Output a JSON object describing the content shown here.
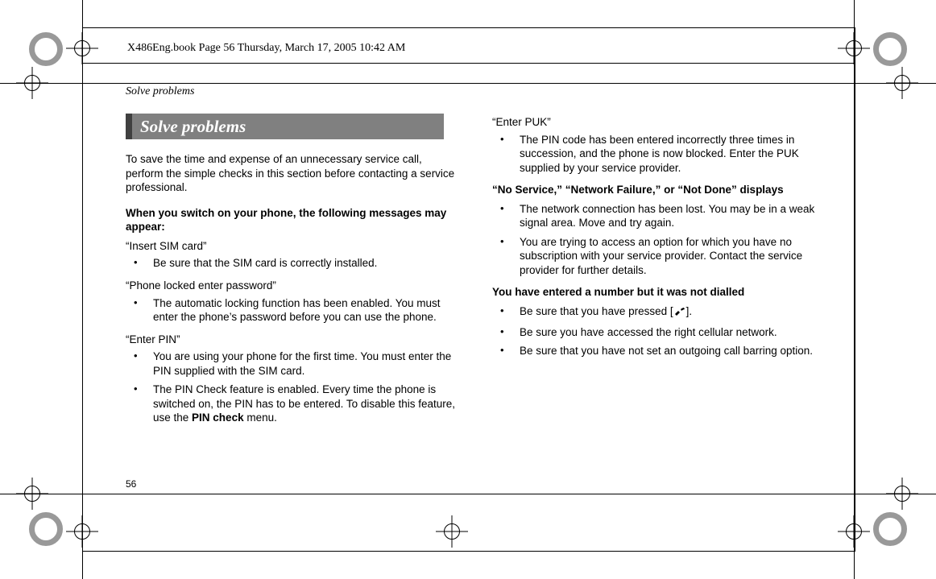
{
  "file_date_line": "X486Eng.book  Page 56  Thursday, March 17, 2005  10:42 AM",
  "running_head": "Solve problems",
  "section_title": "Solve problems",
  "intro": "To save the time and expense of an unnecessary service call, perform the simple checks in this section before contacting a service professional.",
  "page_number": "56",
  "left": {
    "head1": "When you switch on your phone, the following messages may appear:",
    "sub1": "“Insert SIM card”",
    "b1": "Be sure that the SIM card is correctly installed.",
    "sub2": "“Phone locked enter password”",
    "b2": "The automatic locking function has been enabled. You must enter the phone’s password before you can use the phone.",
    "sub3": "“Enter PIN”",
    "b3a": "You are using your phone for the first time. You must enter the PIN supplied with the SIM card.",
    "b3b_pre": "The PIN Check feature is enabled. Every time the phone is switched on, the PIN has to be entered. To disable this feature, use the ",
    "b3b_bold": "PIN check",
    "b3b_post": " menu."
  },
  "right": {
    "sub1": "“Enter PUK”",
    "b1": "The PIN code has been entered incorrectly three times in succession, and the phone is now blocked. Enter the PUK supplied by your service provider.",
    "head2": "“No Service,” “Network Failure,” or “Not Done” displays",
    "b2a": "The network connection has been lost. You may be in a weak signal area. Move and try again.",
    "b2b": "You are trying to access an option for which you have no subscription with your service provider. Contact the service provider for further details.",
    "head3": "You have entered a number but it was not dialled",
    "b3a_pre": "Be sure that you have pressed [",
    "b3a_post": "].",
    "b3b": "Be sure you have accessed the right cellular network.",
    "b3c": "Be sure that you have not set an outgoing call barring option."
  }
}
